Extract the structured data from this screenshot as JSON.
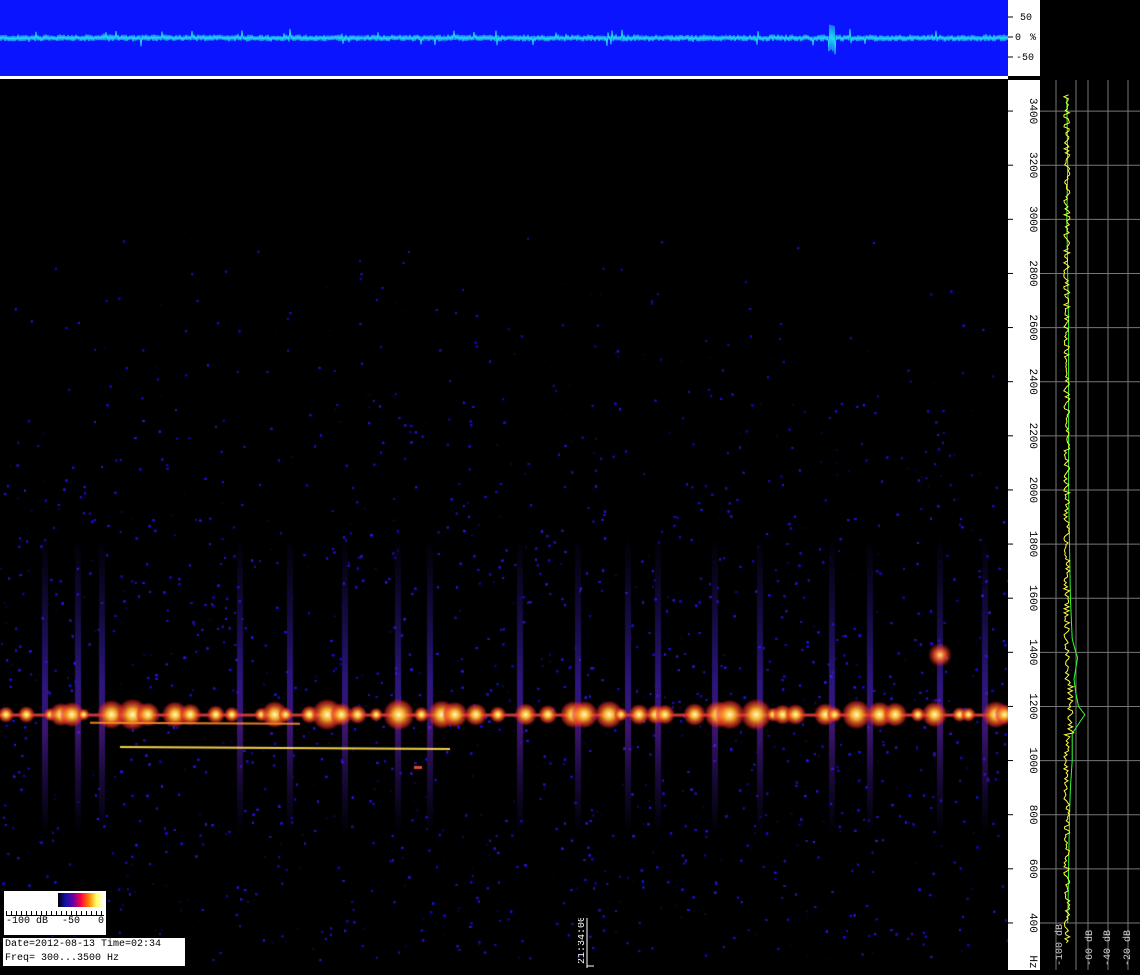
{
  "scope": {
    "tick_labels": [
      "50",
      "0",
      "%",
      "-50"
    ],
    "colors": {
      "background": "#0a14ff",
      "trace": "#22d8ee"
    }
  },
  "colorbar": {
    "label_min": "-100 dB",
    "label_mid": "-50",
    "label_max": "0"
  },
  "info": {
    "line1": "Date=2012-08-13 Time=02:34",
    "line2": "Freq= 300...3500 Hz"
  },
  "time_marker": "21:34:00",
  "colors": {
    "carrier": "#ffd040",
    "spectrum_trace_green": "#30ff30",
    "spectrum_trace_yellow": "#ffff40",
    "spectrum_grid": "#777777"
  },
  "chart_data": [
    {
      "type": "heatmap",
      "title": "",
      "xlabel": "",
      "ylabel": "Hz",
      "ylim": [
        300,
        3500
      ],
      "y_ticks": [
        "400",
        "600",
        "800",
        "1000",
        "1200",
        "1400",
        "1600",
        "1800",
        "2000",
        "2200",
        "2400",
        "2600",
        "2800",
        "3000",
        "3200",
        "3400",
        "Hz"
      ],
      "colorbar_range_db": [
        -100,
        0
      ],
      "features": {
        "carrier_hz": 1170,
        "drift_line_1": {
          "from_hz": 1140,
          "to_hz": 1140
        },
        "drift_line_2": {
          "from_hz": 1050,
          "to_hz": 1050
        },
        "burst_hz": 1390
      }
    },
    {
      "type": "line",
      "title": "",
      "xlabel": "",
      "x_ticks": [
        "-100 dB",
        "-60 dB",
        "-40 dB",
        "-20 dB"
      ],
      "ylim": [
        300,
        3500
      ],
      "series": [
        {
          "freq_hz": [
            3450,
            3200,
            3000,
            2800,
            2600,
            2400,
            2200,
            2000,
            1800,
            1600,
            1450,
            1400,
            1380,
            1300,
            1250,
            1200,
            1170,
            1150,
            1100,
            1000,
            900,
            800,
            600,
            400
          ],
          "level_db": [
            -88,
            -87,
            -88,
            -87,
            -86,
            -86,
            -86,
            -86,
            -85,
            -84,
            -82,
            -78,
            -76,
            -80,
            -78,
            -75,
            -68,
            -72,
            -82,
            -82,
            -84,
            -85,
            -86,
            -87
          ]
        }
      ]
    }
  ]
}
